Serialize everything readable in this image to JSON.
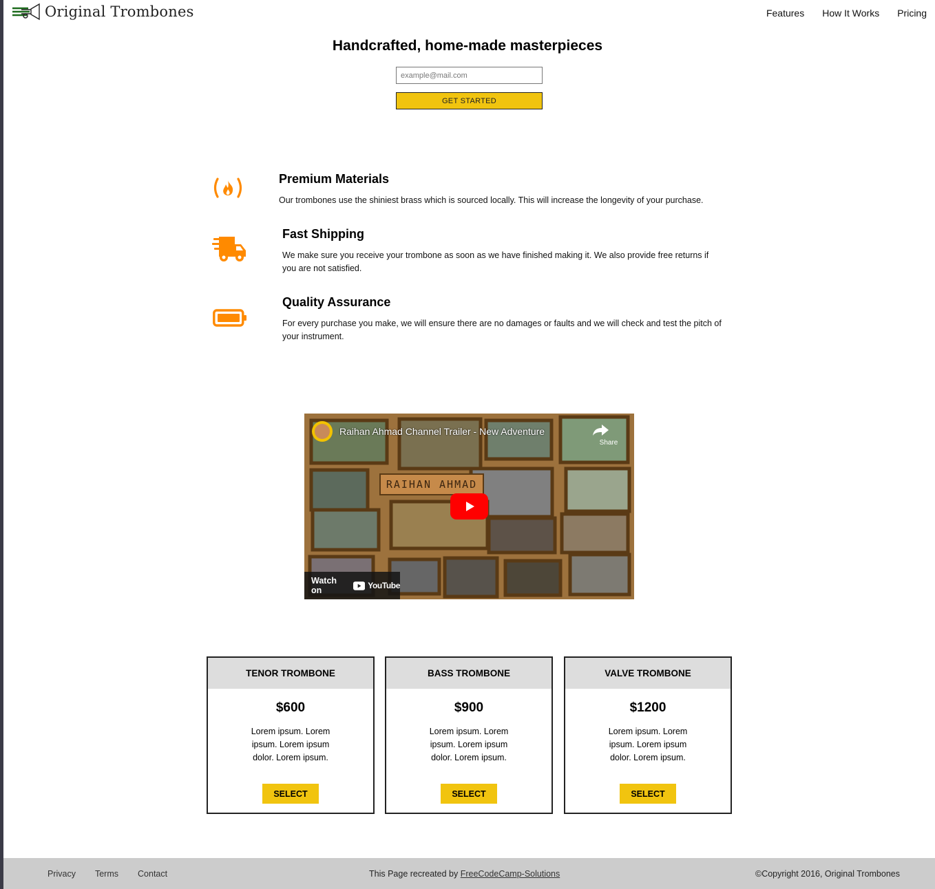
{
  "brand": {
    "name": "Original Trombones",
    "logo_icon": "trombone-icon",
    "logo_color": "#1d6b1d"
  },
  "nav": {
    "items": [
      "Features",
      "How It Works",
      "Pricing"
    ]
  },
  "hero": {
    "title": "Handcrafted, home-made masterpieces",
    "email_placeholder": "example@mail.com",
    "button_label": "GET STARTED"
  },
  "features": [
    {
      "icon": "fire-icon",
      "title": "Premium Materials",
      "description": "Our trombones use the shiniest brass which is sourced locally. This will increase the longevity of your purchase."
    },
    {
      "icon": "shipping-truck-icon",
      "title": "Fast Shipping",
      "description": "We make sure you receive your trombone as soon as we have finished making it. We also provide free returns if you are not satisfied."
    },
    {
      "icon": "battery-icon",
      "title": "Quality Assurance",
      "description": "For every purchase you make, we will ensure there are no damages or faults and we will check and test the pitch of your instrument."
    }
  ],
  "video": {
    "title": "Raihan Ahmad Channel Trailer - New Adventure",
    "share_label": "Share",
    "watch_on_label": "Watch on",
    "platform_label": "YouTube",
    "board_text": "RAIHAN AHMAD"
  },
  "pricing": [
    {
      "name": "TENOR TROMBONE",
      "price": "$600",
      "description": "Lorem ipsum. Lorem ipsum. Lorem ipsum dolor. Lorem ipsum.",
      "button": "SELECT"
    },
    {
      "name": "BASS TROMBONE",
      "price": "$900",
      "description": "Lorem ipsum. Lorem ipsum. Lorem ipsum dolor. Lorem ipsum.",
      "button": "SELECT"
    },
    {
      "name": "VALVE TROMBONE",
      "price": "$1200",
      "description": "Lorem ipsum. Lorem ipsum. Lorem ipsum dolor. Lorem ipsum.",
      "button": "SELECT"
    }
  ],
  "footer": {
    "links": [
      "Privacy",
      "Terms",
      "Contact"
    ],
    "credit_prefix": "This Page recreated by",
    "credit_link": "FreeCodeCamp-Solutions",
    "copyright": "©Copyright 2016, Original Trombones"
  },
  "colors": {
    "accent": "#f1c40f",
    "icon_orange": "#ff8a00",
    "footer_bg": "#cccccc",
    "card_head_bg": "#dddddd"
  }
}
